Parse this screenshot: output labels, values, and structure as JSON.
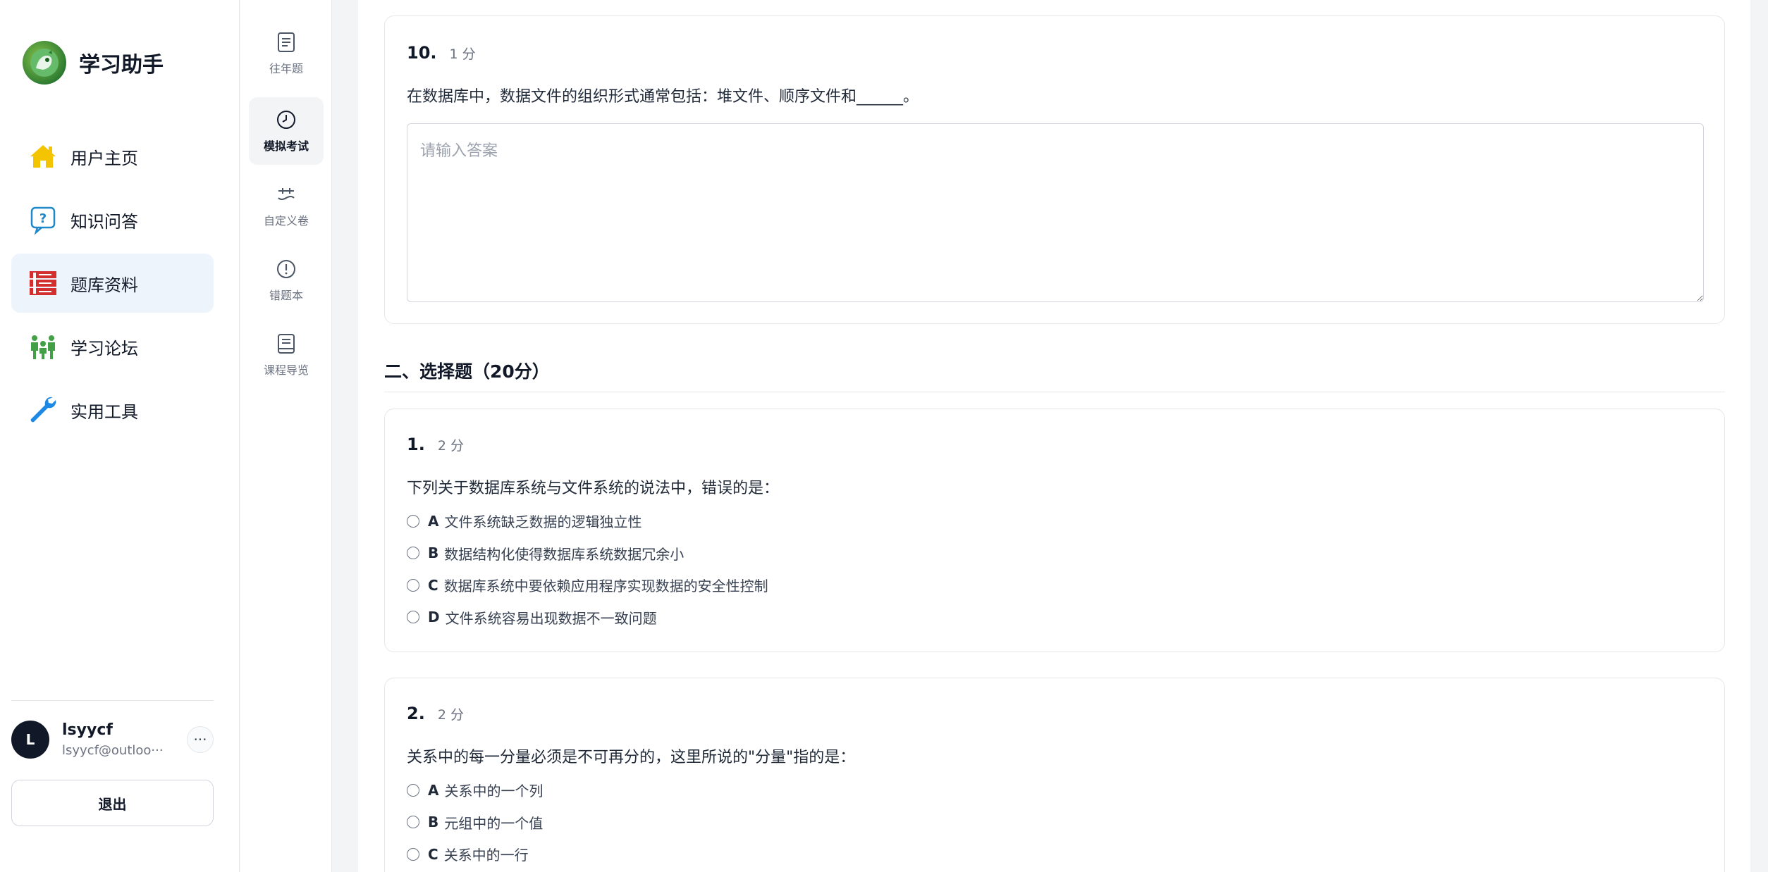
{
  "app": {
    "title": "学习助手"
  },
  "sidebar": {
    "items": [
      {
        "label": "用户主页",
        "icon": "home-icon",
        "color": "#f5c400"
      },
      {
        "label": "知识问答",
        "icon": "question-chat-icon",
        "color": "#1e88c8"
      },
      {
        "label": "题库资料",
        "icon": "question-bank-icon",
        "color": "#d32f2f"
      },
      {
        "label": "学习论坛",
        "icon": "people-forum-icon",
        "color": "#43a047"
      },
      {
        "label": "实用工具",
        "icon": "wrench-icon",
        "color": "#1e88e5"
      }
    ],
    "active_index": 2
  },
  "user": {
    "initial": "L",
    "name": "lsyycf",
    "email": "lsyycf@outloo···",
    "more": "···",
    "logout": "退出"
  },
  "subnav": {
    "items": [
      {
        "label": "往年题",
        "icon": "document-icon"
      },
      {
        "label": "模拟考试",
        "icon": "clock-icon"
      },
      {
        "label": "自定义卷",
        "icon": "customize-icon"
      },
      {
        "label": "错题本",
        "icon": "alert-circle-icon"
      },
      {
        "label": "课程导览",
        "icon": "book-icon"
      }
    ],
    "active_index": 1
  },
  "exam": {
    "fill_question": {
      "number": "10.",
      "score": "1 分",
      "text": "在数据库中，数据文件的组织形式通常包括：堆文件、顺序文件和______。",
      "answer_placeholder": "请输入答案",
      "answer_value": ""
    },
    "section_title": "二、选择题（20分）",
    "choice_questions": [
      {
        "number": "1.",
        "score": "2 分",
        "text": "下列关于数据库系统与文件系统的说法中，错误的是：",
        "options": [
          {
            "letter": "A",
            "text": "文件系统缺乏数据的逻辑独立性"
          },
          {
            "letter": "B",
            "text": "数据结构化使得数据库系统数据冗余小"
          },
          {
            "letter": "C",
            "text": "数据库系统中要依赖应用程序实现数据的安全性控制"
          },
          {
            "letter": "D",
            "text": "文件系统容易出现数据不一致问题"
          }
        ]
      },
      {
        "number": "2.",
        "score": "2 分",
        "text": "关系中的每一分量必须是不可再分的，这里所说的\"分量\"指的是：",
        "options": [
          {
            "letter": "A",
            "text": "关系中的一个列"
          },
          {
            "letter": "B",
            "text": "元组中的一个值"
          },
          {
            "letter": "C",
            "text": "关系中的一行"
          }
        ]
      }
    ]
  }
}
